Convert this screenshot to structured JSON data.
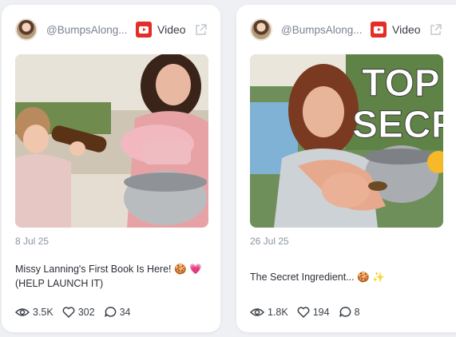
{
  "colors": {
    "background": "#eef0f4",
    "card": "#ffffff",
    "youtube_red": "#e52d27",
    "muted": "#8b93a1"
  },
  "posts": [
    {
      "handle": "@BumpsAlong...",
      "platform_icon": "youtube-icon",
      "type": "Video",
      "date": "8 Jul 25",
      "caption": "Missy Lanning's First Book Is Here! 🍪 💗 (HELP LAUNCH IT)",
      "views": "3.5K",
      "likes": "302",
      "comments": "34"
    },
    {
      "handle": "@BumpsAlong...",
      "platform_icon": "youtube-icon",
      "type": "Video",
      "date": "26 Jul 25",
      "caption": "The Secret Ingredient... 🍪 ✨",
      "thumbnail_text": "TOP SECR",
      "views": "1.8K",
      "likes": "194",
      "comments": "8"
    }
  ]
}
